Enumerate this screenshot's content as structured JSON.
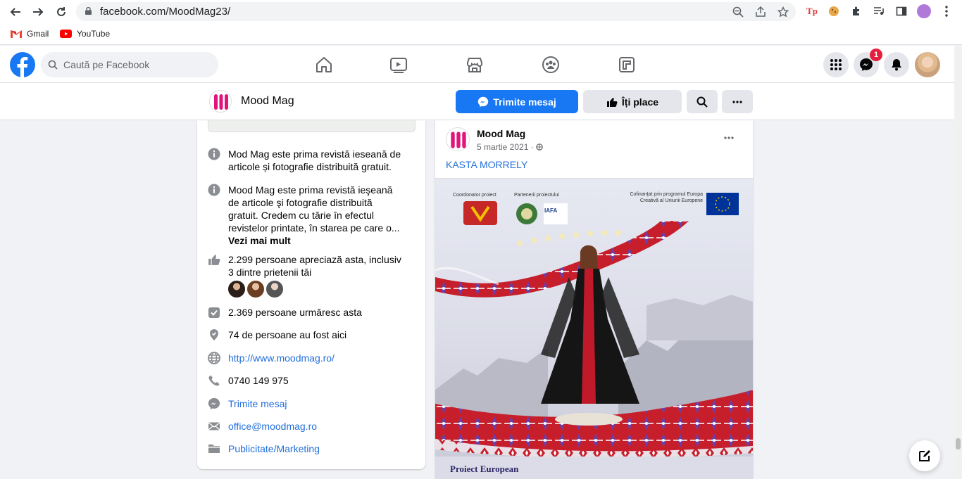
{
  "browser": {
    "url": "facebook.com/MoodMag23/",
    "bookmarks": [
      {
        "label": "Gmail"
      },
      {
        "label": "YouTube"
      }
    ]
  },
  "facebook": {
    "search_placeholder": "Caută pe Facebook",
    "messenger_badge": "1"
  },
  "page": {
    "name": "Mood Mag",
    "send_message_label": "Trimite mesaj",
    "like_label": "Îți place"
  },
  "intro": {
    "short_description": "Mod Mag este prima revistă ieseană de articole și fotografie distribuită gratuit.",
    "long_description": "Mood Mag este prima revistă ieşeană de articole şi fotografie distribuită gratuit. Credem cu tărie în efectul revistelor printate, în starea pe care o...",
    "see_more": "Vezi mai mult",
    "likes": "2.299 persoane apreciază asta, inclusiv 3 dintre prietenii tăi",
    "followers": "2.369 persoane urmăresc asta",
    "checkins": "74 de persoane au fost aici",
    "website": "http://www.moodmag.ro/",
    "phone": "0740 149 975",
    "send_message": "Trimite mesaj",
    "email": "office@moodmag.ro",
    "category": "Publicitate/Marketing"
  },
  "post": {
    "author": "Mood Mag",
    "date": "5 martie 2021",
    "text": "KASTA MORRELY",
    "image": {
      "coordinator_label": "Coordonator proiect",
      "partners_label": "Partenerii proiectului",
      "cofinance_label": "Cofinanțat prin programul Europa Creativă al Uniunii Europene",
      "bottom_title": "Proiect European",
      "partner_logo": "IAFA"
    }
  }
}
